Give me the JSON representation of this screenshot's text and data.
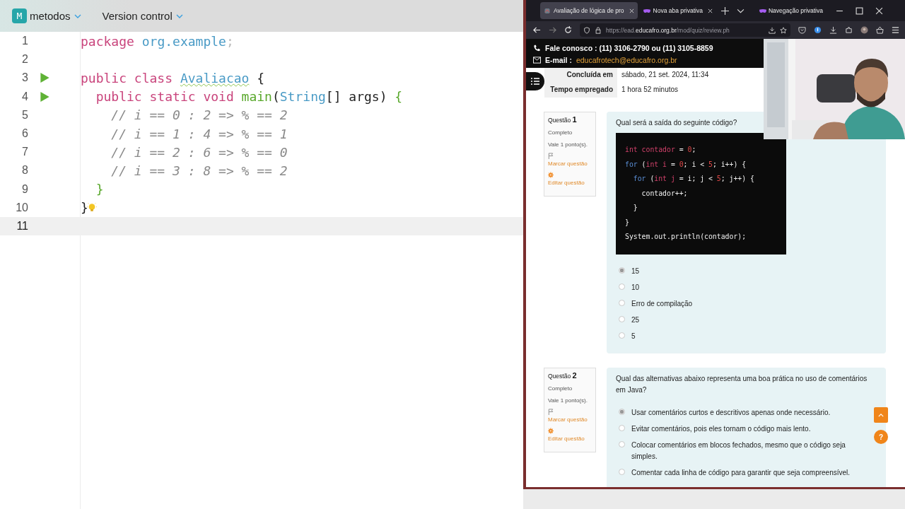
{
  "editor": {
    "project": {
      "badge": "M",
      "name": "metodos"
    },
    "vcs": "Version control",
    "lines": [
      {
        "number": "1",
        "run": false,
        "bulb": false,
        "current": false,
        "tokens": [
          {
            "text": "package ",
            "kind": "keyword"
          },
          {
            "text": "org.example",
            "kind": "package"
          },
          {
            "text": ";",
            "kind": "punct"
          }
        ]
      },
      {
        "number": "2",
        "run": false,
        "bulb": false,
        "current": false
      },
      {
        "number": "3",
        "run": true,
        "bulb": false,
        "current": false,
        "tokens": [
          {
            "text": "public class ",
            "kind": "keyword"
          },
          {
            "text": "Avaliacao",
            "kind": "classname"
          },
          {
            "text": " {",
            "kind": "plain"
          }
        ]
      },
      {
        "number": "4",
        "run": true,
        "bulb": false,
        "current": false,
        "tokens": [
          {
            "text": "  public static void ",
            "kind": "keyword"
          },
          {
            "text": "main",
            "kind": "method"
          },
          {
            "text": "(",
            "kind": "plain"
          },
          {
            "text": "String",
            "kind": "type"
          },
          {
            "text": "[] args) ",
            "kind": "plain"
          },
          {
            "text": "{",
            "kind": "brace"
          }
        ]
      },
      {
        "number": "5",
        "run": false,
        "bulb": false,
        "current": false,
        "tokens": [
          {
            "text": "    // i == 0 : 2 => % == 2",
            "kind": "comment"
          }
        ]
      },
      {
        "number": "6",
        "run": false,
        "bulb": false,
        "current": false,
        "tokens": [
          {
            "text": "    // i == 1 : 4 => % == 1",
            "kind": "comment"
          }
        ]
      },
      {
        "number": "7",
        "run": false,
        "bulb": false,
        "current": false,
        "tokens": [
          {
            "text": "    // i == 2 : 6 => % == 0",
            "kind": "comment"
          }
        ]
      },
      {
        "number": "8",
        "run": false,
        "bulb": false,
        "current": false,
        "tokens": [
          {
            "text": "    // i == 3 : 8 => % == 2",
            "kind": "comment"
          }
        ]
      },
      {
        "number": "9",
        "run": false,
        "bulb": false,
        "current": false,
        "tokens": [
          {
            "text": "  }",
            "kind": "brace"
          }
        ]
      },
      {
        "number": "10",
        "run": false,
        "bulb": true,
        "current": false,
        "tokens": [
          {
            "text": "}",
            "kind": "plain"
          }
        ]
      },
      {
        "number": "11",
        "run": false,
        "bulb": false,
        "current": true
      }
    ]
  },
  "browser": {
    "tabs": [
      {
        "title": "Avaliação de lógica de pro",
        "selected": true,
        "kind": "site"
      },
      {
        "title": "Nova aba privativa",
        "selected": false,
        "kind": "private"
      }
    ],
    "private_label": "Navegação privativa",
    "url": {
      "scheme": "https://ead.",
      "domain": "educafro.org.br",
      "path": "/mod/quiz/review.ph"
    }
  },
  "page": {
    "contact": {
      "phone": "Fale conosco : (11) 3106-2790 ou (11) 3105-8859",
      "email_label": "E-mail :",
      "email": "educafrotech@educafro.org.br"
    },
    "summary": [
      {
        "label": "Concluída em",
        "value": "sábado, 21 set. 2024, 11:34"
      },
      {
        "label": "Tempo empregado",
        "value": "1 hora 52 minutos"
      }
    ],
    "questions": [
      {
        "label": "Questão",
        "number": "1",
        "status": "Completo",
        "points": "Vale 1 ponto(s).",
        "flag": "Marcar questão",
        "edit": "Editar questão",
        "prompt": "Qual será a saída do seguinte código?",
        "code": [
          [
            {
              "text": "int contador",
              "kind": "type"
            },
            {
              "text": " = ",
              "kind": "plain"
            },
            {
              "text": "0",
              "kind": "number"
            },
            {
              "text": ";",
              "kind": "plain"
            }
          ],
          [
            {
              "text": "for",
              "kind": "keyword"
            },
            {
              "text": " (",
              "kind": "plain"
            },
            {
              "text": "int i",
              "kind": "type"
            },
            {
              "text": " = ",
              "kind": "plain"
            },
            {
              "text": "0",
              "kind": "number"
            },
            {
              "text": "; i < ",
              "kind": "plain"
            },
            {
              "text": "5",
              "kind": "number"
            },
            {
              "text": "; i++) {",
              "kind": "plain"
            }
          ],
          [
            {
              "text": "  for",
              "kind": "keyword"
            },
            {
              "text": " (",
              "kind": "plain"
            },
            {
              "text": "int j",
              "kind": "type"
            },
            {
              "text": " = i; j < ",
              "kind": "plain"
            },
            {
              "text": "5",
              "kind": "number"
            },
            {
              "text": "; j++) {",
              "kind": "plain"
            }
          ],
          [
            {
              "text": "    contador++;",
              "kind": "plain"
            }
          ],
          [
            {
              "text": "  }",
              "kind": "plain"
            }
          ],
          [
            {
              "text": "}",
              "kind": "plain"
            }
          ],
          [
            {
              "text": "System.out.println(contador);",
              "kind": "plain"
            }
          ]
        ],
        "options": [
          {
            "label": "15",
            "selected": true
          },
          {
            "label": "10",
            "selected": false
          },
          {
            "label": "Erro de compilação",
            "selected": false
          },
          {
            "label": "25",
            "selected": false
          },
          {
            "label": "5",
            "selected": false
          }
        ]
      },
      {
        "label": "Questão",
        "number": "2",
        "status": "Completo",
        "points": "Vale 1 ponto(s).",
        "flag": "Marcar questão",
        "edit": "Editar questão",
        "prompt": "Qual das alternativas abaixo representa uma boa prática no uso de comentários em Java?",
        "options": [
          {
            "label": "Usar comentários curtos e descritivos apenas onde necessário.",
            "selected": true
          },
          {
            "label": "Evitar comentários, pois eles tornam o código mais lento.",
            "selected": false
          },
          {
            "label": "Colocar comentários em blocos fechados, mesmo que o código seja simples.",
            "selected": false
          },
          {
            "label": "Comentar cada linha de código para garantir que seja compreensível.",
            "selected": false
          }
        ]
      }
    ],
    "help": "?"
  }
}
